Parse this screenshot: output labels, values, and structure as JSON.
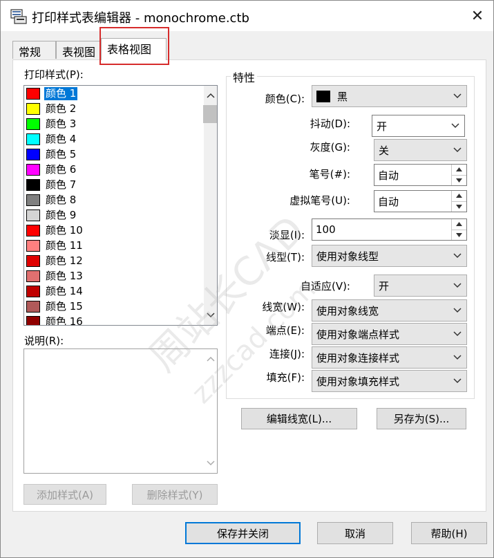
{
  "window": {
    "title": "打印样式表编辑器 - monochrome.ctb",
    "close_glyph": "✕"
  },
  "tabs": [
    {
      "label": "常规",
      "active": false
    },
    {
      "label": "表视图",
      "active": false
    },
    {
      "label": "表格视图",
      "active": true
    }
  ],
  "left": {
    "styles_label": "打印样式(P):",
    "description_label": "说明(R):",
    "add_style_label": "添加样式(A)",
    "delete_style_label": "删除样式(Y)",
    "styles": [
      {
        "label": "颜色 1",
        "color": "#ff0000",
        "selected": true
      },
      {
        "label": "颜色 2",
        "color": "#ffff00",
        "selected": false
      },
      {
        "label": "颜色 3",
        "color": "#00ff00",
        "selected": false
      },
      {
        "label": "颜色 4",
        "color": "#00ffff",
        "selected": false
      },
      {
        "label": "颜色 5",
        "color": "#0000ff",
        "selected": false
      },
      {
        "label": "颜色 6",
        "color": "#ff00ff",
        "selected": false
      },
      {
        "label": "颜色 7",
        "color": "#000000",
        "selected": false
      },
      {
        "label": "颜色 8",
        "color": "#808080",
        "selected": false
      },
      {
        "label": "颜色 9",
        "color": "#d4d4d4",
        "selected": false
      },
      {
        "label": "颜色 10",
        "color": "#ff0000",
        "selected": false
      },
      {
        "label": "颜色 11",
        "color": "#ff8080",
        "selected": false
      },
      {
        "label": "颜色 12",
        "color": "#e00000",
        "selected": false
      },
      {
        "label": "颜色 13",
        "color": "#e07070",
        "selected": false
      },
      {
        "label": "颜色 14",
        "color": "#c00000",
        "selected": false
      },
      {
        "label": "颜色 15",
        "color": "#b05a5a",
        "selected": false
      },
      {
        "label": "颜色 16",
        "color": "#900000",
        "selected": false
      }
    ]
  },
  "properties": {
    "group_title": "特性",
    "color_label": "颜色(C):",
    "color_value": "黑",
    "dither_label": "抖动(D):",
    "dither_value": "开",
    "grayscale_label": "灰度(G):",
    "grayscale_value": "关",
    "pen_label": "笔号(#):",
    "pen_value": "自动",
    "virtual_pen_label": "虚拟笔号(U):",
    "virtual_pen_value": "自动",
    "screening_label": "淡显(I):",
    "screening_value": "100",
    "linetype_label": "线型(T):",
    "linetype_value": "使用对象线型",
    "adaptive_label": "自适应(V):",
    "adaptive_value": "开",
    "lineweight_label": "线宽(W):",
    "lineweight_value": "使用对象线宽",
    "endstyle_label": "端点(E):",
    "endstyle_value": "使用对象端点样式",
    "joinstyle_label": "连接(J):",
    "joinstyle_value": "使用对象连接样式",
    "fillstyle_label": "填充(F):",
    "fillstyle_value": "使用对象填充样式",
    "edit_lineweights_label": "编辑线宽(L)...",
    "save_as_label": "另存为(S)..."
  },
  "footer": {
    "save_close_label": "保存并关闭",
    "cancel_label": "取消",
    "help_label": "帮助(H)"
  },
  "watermark": {
    "text1": "周站长CAD",
    "text2": "zzzcad.com"
  },
  "colors": {
    "selection": "#0078d7",
    "highlight_box": "#d62b2b"
  }
}
